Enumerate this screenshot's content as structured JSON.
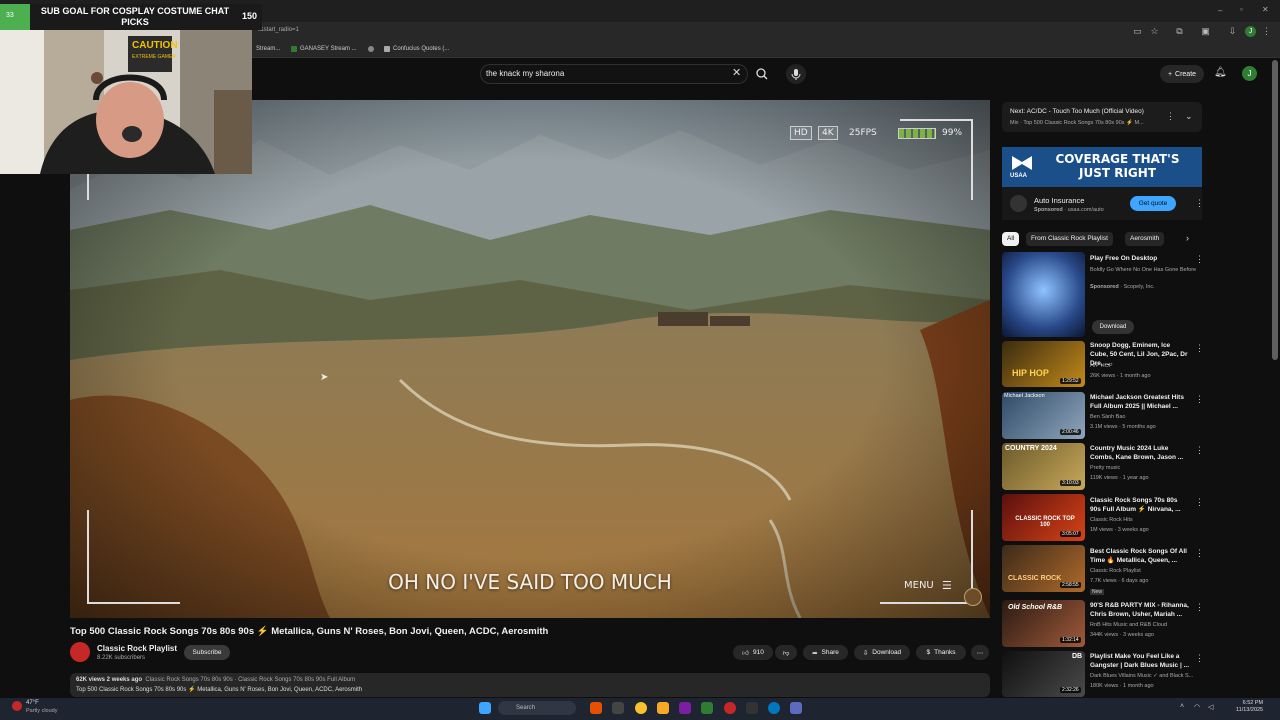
{
  "stream_overlay": {
    "goal_current": "33",
    "goal_text": "SUB GOAL FOR COSPLAY COSTUME CHAT PICKS",
    "goal_max": "150",
    "poster_text": "CAUTION",
    "poster_subtext": "EXTREME GAMER"
  },
  "browser": {
    "url_fragment": "t&start_radio=1",
    "bookmarks": [
      "Stream...",
      "GANASEY Stream ...",
      "Confucius Quotes (..."
    ],
    "profile_initial": "J"
  },
  "masthead": {
    "search_value": "the knack my sharona",
    "create_label": "Create",
    "avatar_initial": "J"
  },
  "player": {
    "hud_hd": "HD",
    "hud_4k": "4K",
    "hud_fps": "25FPS",
    "hud_battery": "99%",
    "lyric": "OH NO I'VE SAID TOO MUCH",
    "menu_label": "MENU"
  },
  "video": {
    "title": "Top 500 Classic Rock Songs 70s 80s 90s ⚡ Metallica, Guns N' Roses, Bon Jovi, Queen, ACDC, Aerosmith",
    "channel": "Classic Rock Playlist",
    "subscribers": "8.22K subscribers",
    "subscribe_label": "Subscribe",
    "likes": "910",
    "share_label": "Share",
    "download_label": "Download",
    "thanks_label": "Thanks",
    "desc_line1_stats": "62K views  2 weeks ago",
    "desc_line1_tags": "Classic Rock Songs 70s 80s 90s · Classic Rock Songs 70s 80s 90s Full Album",
    "desc_line2": "Top 500 Classic Rock Songs 70s 80s 90s ⚡ Metallica, Guns N' Roses, Bon Jovi, Queen, ACDC, Aerosmith"
  },
  "sidebar": {
    "next_line1": "Next: AC/DC - Touch Too Much (Official Video)",
    "next_line2": "Mix · Top 500 Classic Rock Songs 70s 80s 90s ⚡ M...",
    "ad": {
      "brand": "USAA",
      "headline": "COVERAGE THAT'S JUST RIGHT",
      "title": "Auto Insurance",
      "sponsored": "Sponsored",
      "domain": "· usaa.com/auto",
      "cta": "Get quote"
    },
    "chips": [
      "All",
      "From Classic Rock Playlist",
      "Aerosmith"
    ],
    "sponsored_rec": {
      "title": "Play Free On Desktop",
      "desc": "Boldly Go Where No One Has Gone Before",
      "sponsored": "Sponsored",
      "advertiser": "· Scopely, Inc.",
      "download": "Download"
    },
    "recs": [
      {
        "title": "Snoop Dogg, Eminem, Ice Cube, 50 Cent, Lil Jon, 2Pac, Dr Dre, ...",
        "channel": "HIP HOP",
        "meta": "26K views · 1 month ago",
        "duration": "1:29:52",
        "thumb_text": "HIP HOP"
      },
      {
        "title": "Michael Jackson Greatest Hits Full Album 2025 || Michael ...",
        "channel": "Ben Sành Bao",
        "meta": "3.1M views · 5 months ago",
        "duration": "2:00:46",
        "thumb_text": "Michael Jackson"
      },
      {
        "title": "Country Music 2024 Luke Combs, Kane Brown, Jason ...",
        "channel": "Pretty music",
        "meta": "119K views · 1 year ago",
        "duration": "3:10:03",
        "thumb_text": "COUNTRY 2024"
      },
      {
        "title": "Classic Rock Songs 70s 80s 90s Full Album ⚡ Nirvana, ...",
        "channel": "Classic Rock Hits",
        "meta": "1M views · 3 weeks ago",
        "duration": "3:05:07",
        "thumb_text": "CLASSIC ROCK TOP 100"
      },
      {
        "title": "Best Classic Rock Songs Of All Time 🔥 Metallica, Queen, ...",
        "channel": "Classic Rock Playlist",
        "meta": "7.7K views · 6 days ago",
        "duration": "2:58:55",
        "thumb_text": "CLASSIC ROCK",
        "badge": "New"
      },
      {
        "title": "90'S R&B PARTY MIX - Rihanna, Chris Brown, Usher, Mariah ...",
        "channel": "RnB Hits Music and R&B Cloud",
        "meta": "344K views · 3 weeks ago",
        "duration": "1:32:14",
        "thumb_text": "Old School R&B"
      },
      {
        "title": "Playlist Make You Feel Like a Gangster | Dark Blues Music | ...",
        "channel": "Dark Blues Villains Music ✓ and Black S...",
        "meta": "180K views · 1 month ago",
        "duration": "2:32:26",
        "thumb_text": "DB"
      }
    ]
  },
  "taskbar": {
    "weather_temp": "47°F",
    "weather_desc": "Partly cloudy",
    "search_placeholder": "Search",
    "time": "6:52 PM",
    "date": "11/13/2025"
  },
  "colors": {
    "background": "#0f0f0f",
    "accent_blue": "#3ea6ff",
    "goal_green": "#4caf50",
    "usaa_blue": "#1b4f8a"
  }
}
